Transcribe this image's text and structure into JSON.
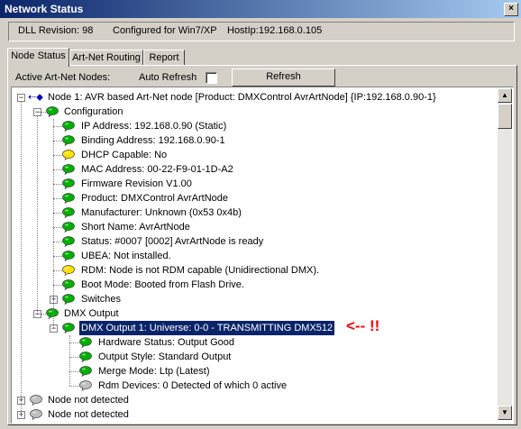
{
  "window": {
    "title": "Network Status",
    "close_label": "×"
  },
  "info": {
    "dll_revision": "DLL Revision: 98",
    "configured": "Configured for Win7/XP",
    "hostip": "HostIp:192.168.0.105"
  },
  "tabs": [
    {
      "label": "Node Status",
      "active": true
    },
    {
      "label": "Art-Net Routing"
    },
    {
      "label": "Report"
    }
  ],
  "controls": {
    "active_nodes_label": "Active Art-Net Nodes:",
    "auto_refresh_label": "Auto Refresh",
    "auto_refresh_checked": false,
    "refresh_button": "Refresh"
  },
  "tree": {
    "node1": "Node 1: AVR based Art-Net node [Product: DMXControl AvrArtNode] {IP:192.168.0.90-1}",
    "configuration": "Configuration",
    "config_items": [
      {
        "text": "IP Address: 192.168.0.90 (Static)",
        "icon": "green-bubble-icon"
      },
      {
        "text": "Binding Address: 192.168.0.90-1",
        "icon": "green-bubble-icon"
      },
      {
        "text": "DHCP Capable: No",
        "icon": "yellow-bubble-icon"
      },
      {
        "text": "MAC Address: 00-22-F9-01-1D-A2",
        "icon": "green-bubble-icon"
      },
      {
        "text": "Firmware Revision V1.00",
        "icon": "green-bubble-icon"
      },
      {
        "text": "Product: DMXControl AvrArtNode",
        "icon": "green-bubble-icon"
      },
      {
        "text": "Manufacturer: Unknown (0x53 0x4b)",
        "icon": "green-bubble-icon"
      },
      {
        "text": "Short Name: AvrArtNode",
        "icon": "green-bubble-icon"
      },
      {
        "text": "Status: #0007 [0002] AvrArtNode is ready",
        "icon": "green-bubble-icon"
      },
      {
        "text": "UBEA: Not installed.",
        "icon": "green-bubble-icon"
      },
      {
        "text": "RDM: Node is not RDM capable (Unidirectional DMX).",
        "icon": "yellow-bubble-icon"
      },
      {
        "text": "Boot Mode: Booted from Flash Drive.",
        "icon": "green-bubble-icon"
      }
    ],
    "switches": "Switches",
    "dmx_output": "DMX Output",
    "dmx_output_1": "DMX Output 1: Universe: 0-0  - TRANSMITTING DMX512",
    "output_items": [
      {
        "text": "Hardware Status: Output Good",
        "icon": "green-bubble-icon"
      },
      {
        "text": "Output Style: Standard Output",
        "icon": "green-bubble-icon"
      },
      {
        "text": "Merge Mode: Ltp (Latest)",
        "icon": "green-bubble-icon"
      },
      {
        "text": "Rdm Devices: 0 Detected of which 0 active",
        "icon": "gray-bubble-icon"
      }
    ],
    "not_detected": [
      "Node not detected",
      "Node not detected"
    ]
  },
  "annotation": "<-- !!",
  "colors": {
    "green": "#00b000",
    "yellow": "#ffe000",
    "gray": "#c0c0c0",
    "selection": "#0a246a",
    "annotation": "#ff0000"
  }
}
